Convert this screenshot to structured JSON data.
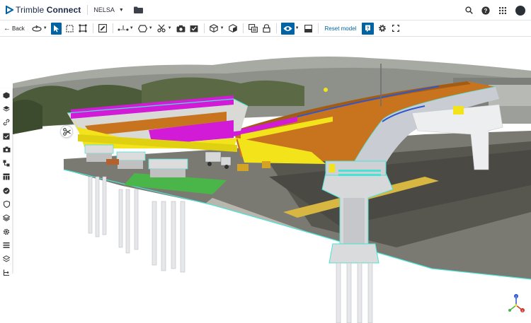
{
  "header": {
    "brand_light": "Trimble",
    "brand_bold": "Connect",
    "project_name": "NELSA",
    "icons": [
      "trimble-logo-icon",
      "chevron-down-icon",
      "folder-icon",
      "search-icon",
      "help-icon",
      "apps-grid-icon",
      "user-avatar"
    ]
  },
  "toolbar": {
    "back_label": "Back",
    "reset_label": "Reset model",
    "tools": [
      "orbit-icon",
      "select-icon",
      "box-select-icon",
      "fit-box-icon",
      "pencil-markup-icon",
      "measure-icon",
      "shape-icon",
      "section-icon",
      "screenshot-icon",
      "snapshot-icon",
      "cube-icon",
      "iso-cube-icon",
      "clash-icon",
      "lock-icon",
      "visibility-icon",
      "panel-icon",
      "help-icon",
      "settings-icon",
      "fullscreen-icon"
    ],
    "active_tools": [
      "select-icon",
      "visibility-icon",
      "help-icon"
    ]
  },
  "leftbar": {
    "items": [
      "models-icon",
      "layers-icon",
      "link-icon",
      "checklist-icon",
      "camera-icon",
      "organizer-icon",
      "list-icon",
      "table-icon",
      "status-icon",
      "shield-icon",
      "stack-icon",
      "gear-icon",
      "lines-icon",
      "layers-alt-icon",
      "tree-icon"
    ]
  },
  "colors": {
    "accent": "#0063a3",
    "deck_orange": "#c8741f",
    "girder_yellow": "#f2e31b",
    "barrier_magenta": "#d11bd6",
    "outline_cyan": "#49e3d6"
  }
}
